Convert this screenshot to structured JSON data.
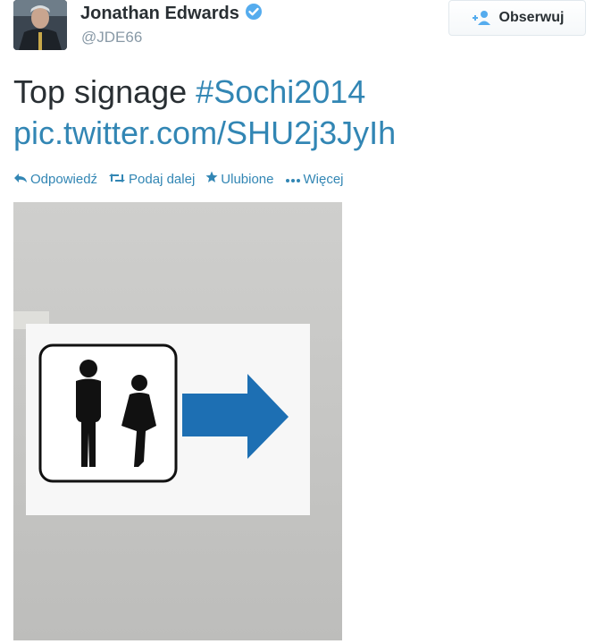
{
  "author": {
    "name": "Jonathan Edwards",
    "handle": "@JDE66",
    "verified": true
  },
  "follow_button": {
    "label": "Obserwuj",
    "icon": "add-user-icon"
  },
  "tweet": {
    "text": "Top signage",
    "hashtag": "#Sochi2014",
    "link": "pic.twitter.com/SHU2j3JyIh"
  },
  "actions": [
    {
      "label": "Odpowiedź",
      "icon": "reply-icon"
    },
    {
      "label": "Podaj dalej",
      "icon": "retweet-icon"
    },
    {
      "label": "Ulubione",
      "icon": "star-icon"
    },
    {
      "label": "Więcej",
      "icon": "more-icon"
    }
  ],
  "colors": {
    "link": "#3286b4",
    "verified": "#55acee",
    "handle": "#8899a6",
    "arrow": "#1d6fb3"
  }
}
